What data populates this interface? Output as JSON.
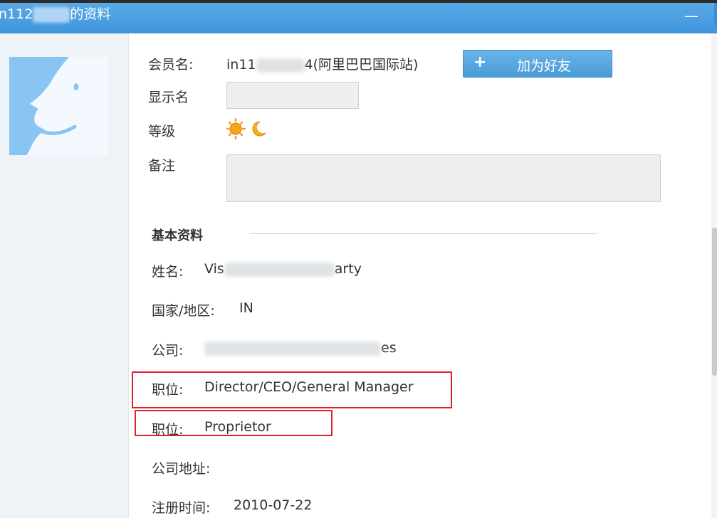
{
  "window": {
    "title_prefix": "n112",
    "title_suffix": "的资料",
    "minimize": "—"
  },
  "profile": {
    "member_label": "会员名:",
    "member_prefix": "in11",
    "member_suffix": "4(阿里巴巴国际站)",
    "add_friend_plus": "+",
    "add_friend_label": "加为好友",
    "display_name_label": "显示名",
    "level_label": "等级",
    "note_label": "备注"
  },
  "basic": {
    "section_title": "基本资料",
    "name_label": "姓名:",
    "name_prefix": "Vis",
    "name_suffix": "arty",
    "country_label": "国家/地区:",
    "country_value": "IN",
    "company_label": "公司:",
    "company_suffix": "es",
    "position1_label": "职位:",
    "position1_value": "Director/CEO/General Manager",
    "position2_label": "职位:",
    "position2_value": "Proprietor",
    "address_label": "公司地址:",
    "register_label": "注册时间:",
    "register_value": "2010-07-22"
  },
  "icons": {
    "level_sun": "sun-icon",
    "level_moon": "moon-icon",
    "avatar": "default-avatar-face-icon"
  },
  "colors": {
    "title_bar": "#4a9de0",
    "button": "#5aa7e2",
    "highlight": "#e02030"
  }
}
